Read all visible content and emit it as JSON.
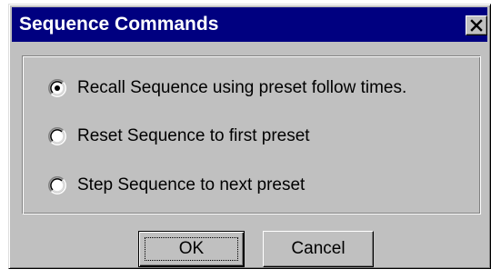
{
  "window": {
    "title": "Sequence Commands",
    "close_icon": "close-x-icon"
  },
  "options": [
    {
      "label": "Recall Sequence using preset follow times.",
      "selected": true
    },
    {
      "label": "Reset Sequence to first preset",
      "selected": false
    },
    {
      "label": "Step Sequence to next preset",
      "selected": false
    }
  ],
  "buttons": {
    "ok_label": "OK",
    "cancel_label": "Cancel"
  },
  "colors": {
    "title_bar": "#000080",
    "face": "#c0c0c0",
    "title_text": "#ffffff"
  }
}
